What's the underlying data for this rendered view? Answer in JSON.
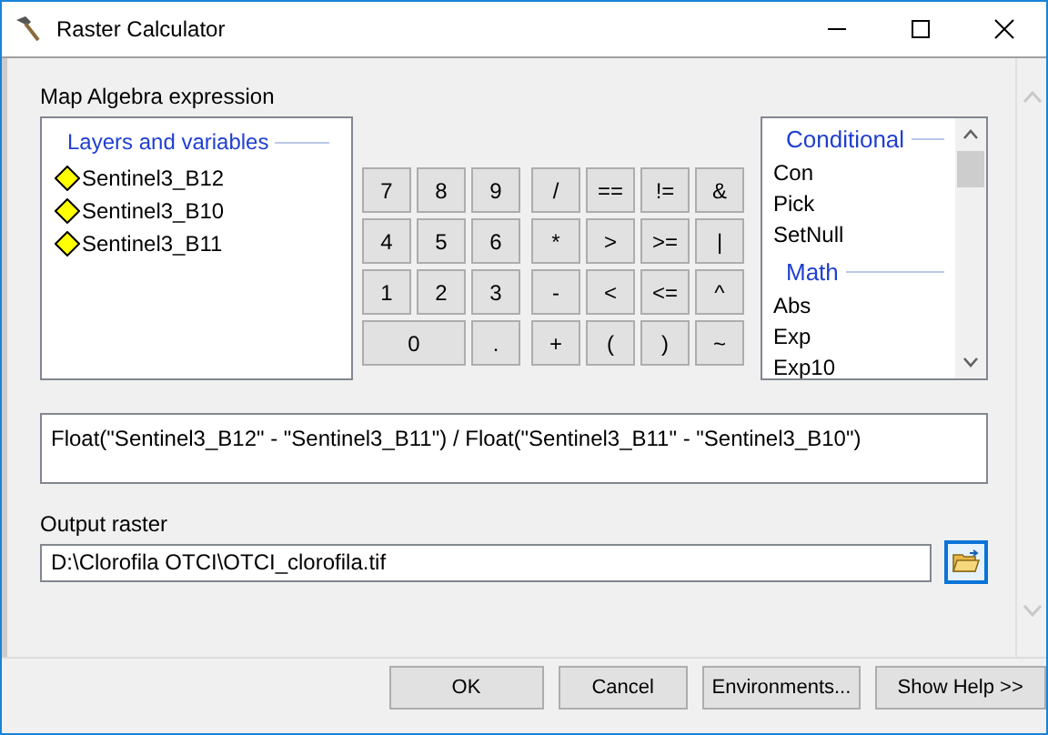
{
  "window": {
    "title": "Raster Calculator"
  },
  "expression_label": "Map Algebra expression",
  "layers": {
    "title": "Layers and variables",
    "items": [
      {
        "name": "Sentinel3_B12"
      },
      {
        "name": "Sentinel3_B10"
      },
      {
        "name": "Sentinel3_B11"
      }
    ]
  },
  "digit_keys": [
    {
      "label": "7",
      "kind": "normal"
    },
    {
      "label": "8",
      "kind": "normal"
    },
    {
      "label": "9",
      "kind": "normal"
    },
    {
      "label": "4",
      "kind": "normal"
    },
    {
      "label": "5",
      "kind": "normal"
    },
    {
      "label": "6",
      "kind": "normal"
    },
    {
      "label": "1",
      "kind": "normal"
    },
    {
      "label": "2",
      "kind": "normal"
    },
    {
      "label": "3",
      "kind": "normal"
    },
    {
      "label": "0",
      "kind": "wide"
    },
    {
      "label": ".",
      "kind": "normal"
    }
  ],
  "operator_keys": [
    "/",
    "==",
    "!=",
    "&",
    "*",
    ">",
    ">=",
    "|",
    "-",
    "<",
    "<=",
    "^",
    "+",
    "(",
    ")",
    "~"
  ],
  "functions": [
    {
      "header": "Conditional",
      "items": [
        "Con",
        "Pick",
        "SetNull"
      ]
    },
    {
      "header": "Math",
      "items": [
        "Abs",
        "Exp",
        "Exp10"
      ]
    }
  ],
  "expression": "Float(\"Sentinel3_B12\" - \"Sentinel3_B11\") / Float(\"Sentinel3_B11\" - \"Sentinel3_B10\")",
  "output": {
    "label": "Output raster",
    "value": "D:\\Clorofila OTCI\\OTCI_clorofila.tif"
  },
  "buttons": [
    "OK",
    "Cancel",
    "Environments...",
    "Show Help >>"
  ]
}
